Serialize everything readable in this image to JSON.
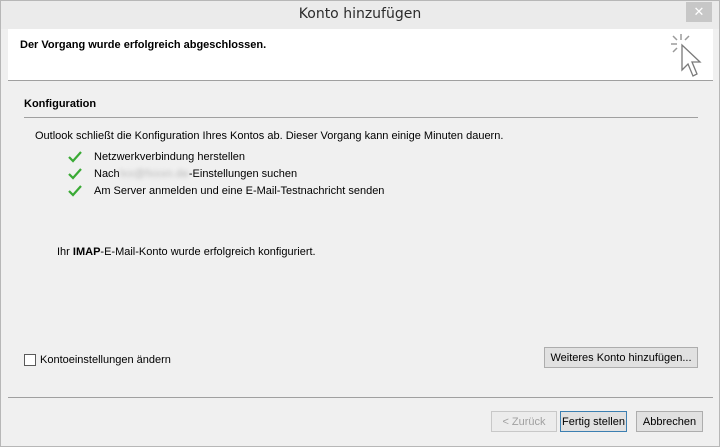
{
  "window": {
    "title": "Konto hinzufügen",
    "close_label": "✕"
  },
  "header": {
    "message": "Der Vorgang wurde erfolgreich abgeschlossen."
  },
  "section": {
    "title": "Konfiguration",
    "description": "Outlook schließt die Konfiguration Ihres Kontos ab. Dieser Vorgang kann einige Minuten dauern."
  },
  "steps": [
    {
      "label": "Netzwerkverbindung herstellen",
      "status": "done"
    },
    {
      "prefix": "Nach",
      "blurred": "lxx@fxxxn.de",
      "suffix": "-Einstellungen suchen",
      "status": "done"
    },
    {
      "label": "Am Server anmelden und eine E-Mail-Testnachricht senden",
      "status": "done"
    }
  ],
  "result": {
    "prefix": "Ihr ",
    "protocol": "IMAP",
    "suffix": "-E-Mail-Konto wurde erfolgreich konfiguriert."
  },
  "options": {
    "change_settings_label": "Kontoeinstellungen ändern",
    "change_settings_checked": false,
    "add_another_label": "Weiteres Konto hinzufügen..."
  },
  "buttons": {
    "back": "< Zurück",
    "finish": "Fertig stellen",
    "cancel": "Abbrechen"
  },
  "colors": {
    "check": "#3aaa35",
    "accent_border": "#3c7fb1"
  }
}
